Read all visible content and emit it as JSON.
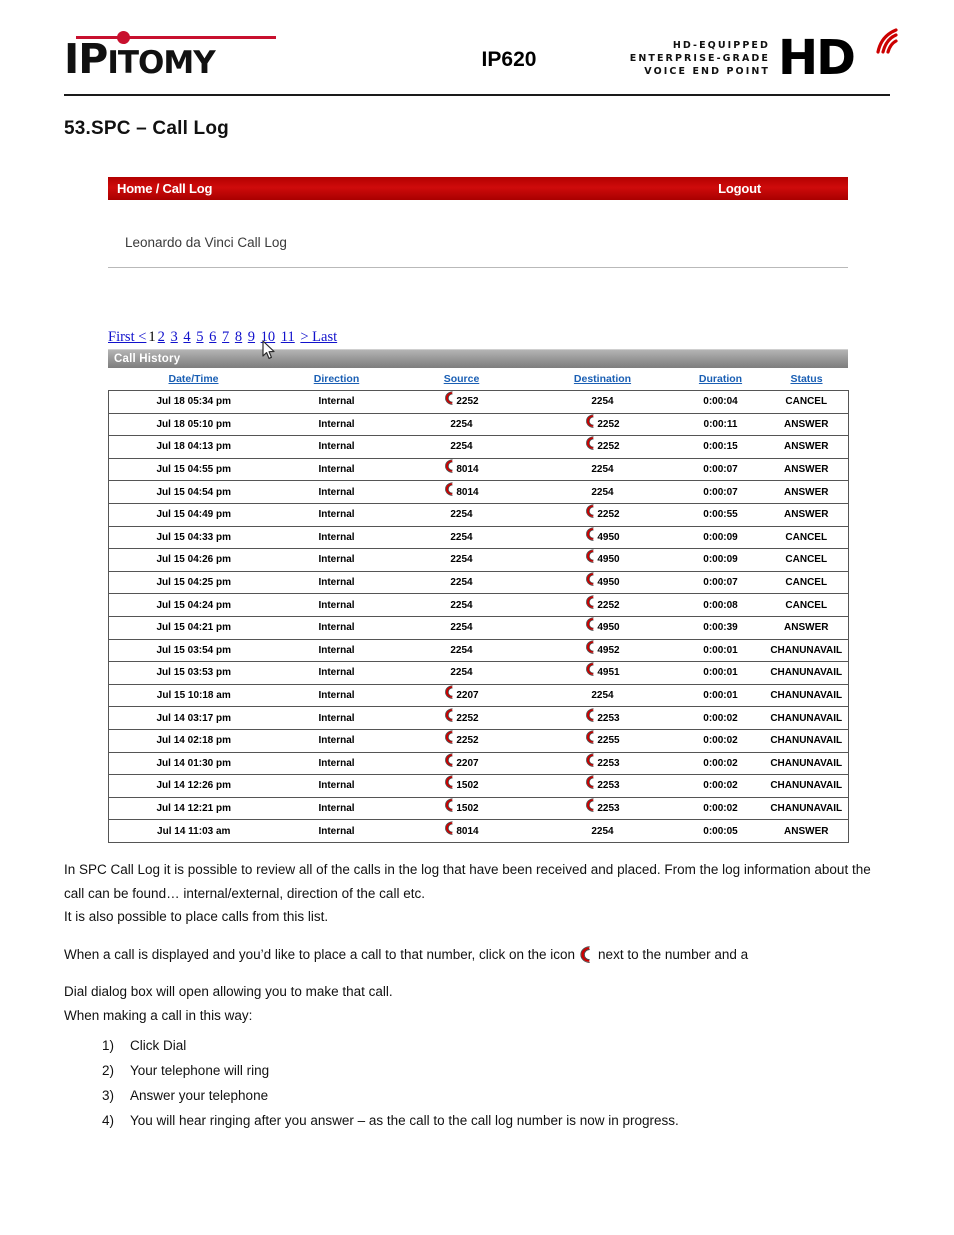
{
  "header": {
    "brand": {
      "lead": "IP",
      "tail": "ITOMY",
      "icon": "ipitomy-logo"
    },
    "model": "IP620",
    "hd_badge": {
      "line1": "HD-EQUIPPED",
      "line2": "ENTERPRISE-GRADE",
      "line3": "VOICE END POINT",
      "mark": "HD",
      "waves_icon": "signal-waves-icon"
    }
  },
  "doc": {
    "title": "53.SPC – Call Log"
  },
  "webui": {
    "nav": {
      "breadcrumb": "Home / Call Log",
      "logout": "Logout"
    },
    "subtitle": "Leonardo da Vinci Call Log",
    "pager": {
      "first": "First <",
      "current": "1",
      "pages": [
        "2",
        "3",
        "4",
        "5",
        "6",
        "7",
        "8",
        "9",
        "10",
        "11"
      ],
      "last": "> Last"
    },
    "table": {
      "caption": "Call History",
      "columns": [
        "Date/Time",
        "Direction",
        "Source",
        "Destination",
        "Duration",
        "Status"
      ],
      "rows": [
        {
          "datetime": "Jul 18 05:34 pm",
          "direction": "Internal",
          "source": "2252",
          "source_icon": true,
          "destination": "2254",
          "destination_icon": false,
          "duration": "0:00:04",
          "status": "CANCEL"
        },
        {
          "datetime": "Jul 18 05:10 pm",
          "direction": "Internal",
          "source": "2254",
          "source_icon": false,
          "destination": "2252",
          "destination_icon": true,
          "duration": "0:00:11",
          "status": "ANSWER"
        },
        {
          "datetime": "Jul 18 04:13 pm",
          "direction": "Internal",
          "source": "2254",
          "source_icon": false,
          "destination": "2252",
          "destination_icon": true,
          "duration": "0:00:15",
          "status": "ANSWER"
        },
        {
          "datetime": "Jul 15 04:55 pm",
          "direction": "Internal",
          "source": "8014",
          "source_icon": true,
          "destination": "2254",
          "destination_icon": false,
          "duration": "0:00:07",
          "status": "ANSWER"
        },
        {
          "datetime": "Jul 15 04:54 pm",
          "direction": "Internal",
          "source": "8014",
          "source_icon": true,
          "destination": "2254",
          "destination_icon": false,
          "duration": "0:00:07",
          "status": "ANSWER"
        },
        {
          "datetime": "Jul 15 04:49 pm",
          "direction": "Internal",
          "source": "2254",
          "source_icon": false,
          "destination": "2252",
          "destination_icon": true,
          "duration": "0:00:55",
          "status": "ANSWER"
        },
        {
          "datetime": "Jul 15 04:33 pm",
          "direction": "Internal",
          "source": "2254",
          "source_icon": false,
          "destination": "4950",
          "destination_icon": true,
          "duration": "0:00:09",
          "status": "CANCEL"
        },
        {
          "datetime": "Jul 15 04:26 pm",
          "direction": "Internal",
          "source": "2254",
          "source_icon": false,
          "destination": "4950",
          "destination_icon": true,
          "duration": "0:00:09",
          "status": "CANCEL"
        },
        {
          "datetime": "Jul 15 04:25 pm",
          "direction": "Internal",
          "source": "2254",
          "source_icon": false,
          "destination": "4950",
          "destination_icon": true,
          "duration": "0:00:07",
          "status": "CANCEL"
        },
        {
          "datetime": "Jul 15 04:24 pm",
          "direction": "Internal",
          "source": "2254",
          "source_icon": false,
          "destination": "2252",
          "destination_icon": true,
          "duration": "0:00:08",
          "status": "CANCEL"
        },
        {
          "datetime": "Jul 15 04:21 pm",
          "direction": "Internal",
          "source": "2254",
          "source_icon": false,
          "destination": "4950",
          "destination_icon": true,
          "duration": "0:00:39",
          "status": "ANSWER"
        },
        {
          "datetime": "Jul 15 03:54 pm",
          "direction": "Internal",
          "source": "2254",
          "source_icon": false,
          "destination": "4952",
          "destination_icon": true,
          "duration": "0:00:01",
          "status": "CHANUNAVAIL"
        },
        {
          "datetime": "Jul 15 03:53 pm",
          "direction": "Internal",
          "source": "2254",
          "source_icon": false,
          "destination": "4951",
          "destination_icon": true,
          "duration": "0:00:01",
          "status": "CHANUNAVAIL"
        },
        {
          "datetime": "Jul 15 10:18 am",
          "direction": "Internal",
          "source": "2207",
          "source_icon": true,
          "destination": "2254",
          "destination_icon": false,
          "duration": "0:00:01",
          "status": "CHANUNAVAIL"
        },
        {
          "datetime": "Jul 14 03:17 pm",
          "direction": "Internal",
          "source": "2252",
          "source_icon": true,
          "destination": "2253",
          "destination_icon": true,
          "duration": "0:00:02",
          "status": "CHANUNAVAIL"
        },
        {
          "datetime": "Jul 14 02:18 pm",
          "direction": "Internal",
          "source": "2252",
          "source_icon": true,
          "destination": "2255",
          "destination_icon": true,
          "duration": "0:00:02",
          "status": "CHANUNAVAIL"
        },
        {
          "datetime": "Jul 14 01:30 pm",
          "direction": "Internal",
          "source": "2207",
          "source_icon": true,
          "destination": "2253",
          "destination_icon": true,
          "duration": "0:00:02",
          "status": "CHANUNAVAIL"
        },
        {
          "datetime": "Jul 14 12:26 pm",
          "direction": "Internal",
          "source": "1502",
          "source_icon": true,
          "destination": "2253",
          "destination_icon": true,
          "duration": "0:00:02",
          "status": "CHANUNAVAIL"
        },
        {
          "datetime": "Jul 14 12:21 pm",
          "direction": "Internal",
          "source": "1502",
          "source_icon": true,
          "destination": "2253",
          "destination_icon": true,
          "duration": "0:00:02",
          "status": "CHANUNAVAIL"
        },
        {
          "datetime": "Jul 14 11:03 am",
          "direction": "Internal",
          "source": "8014",
          "source_icon": true,
          "destination": "2254",
          "destination_icon": false,
          "duration": "0:00:05",
          "status": "ANSWER"
        }
      ]
    }
  },
  "body": {
    "para1": "In SPC Call Log it is possible to review all of the calls in the log that have been received and placed. From the log information about the call can be found… internal/external, direction of the call etc.",
    "para2": "It is also possible to place calls from this list.",
    "para3_before": "When a call is displayed and you’d like to place a call to that number, click on the icon",
    "para3_after": "next to the number and a",
    "para4": "Dial dialog box will open allowing you to make that call.",
    "para5": "When making a call in this way:",
    "steps": [
      {
        "marker": "1)",
        "text": "Click Dial"
      },
      {
        "marker": "2)",
        "text": "Your telephone will ring"
      },
      {
        "marker": "3)",
        "text": "Answer your telephone"
      },
      {
        "marker": "4)",
        "text": "You will hear ringing after you answer – as the call to the call log number is now in progress."
      }
    ]
  },
  "colors": {
    "brand_red": "#c8102e",
    "nav_red": "#b30000",
    "link_blue": "#1111cc",
    "header_link_blue": "#1a5fb4",
    "status_cancel": "#2222cc",
    "status_answer": "#1e7d32",
    "status_unavail": "#e00000",
    "handset_red": "#cc0000"
  }
}
